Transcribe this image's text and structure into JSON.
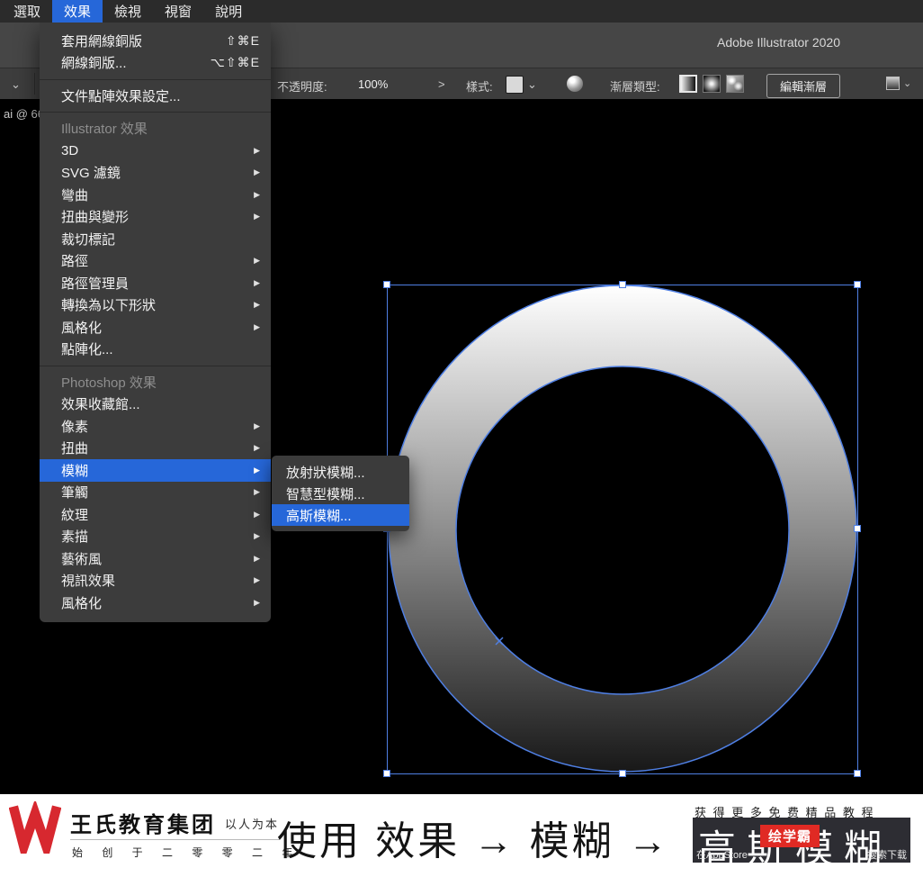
{
  "menubar": {
    "items": [
      {
        "label": "選取",
        "active": false
      },
      {
        "label": "效果",
        "active": true
      },
      {
        "label": "檢視",
        "active": false
      },
      {
        "label": "視窗",
        "active": false
      },
      {
        "label": "說明",
        "active": false
      }
    ]
  },
  "titlebar": {
    "title": "Adobe Illustrator 2020"
  },
  "controlbar": {
    "opacity_label": "不透明度:",
    "opacity_value": "100%",
    "style_label": "樣式:",
    "gradient_type_label": "漸層類型:",
    "edit_gradient_button": "編輯漸層"
  },
  "document": {
    "tab_fragment": "ai @ 66"
  },
  "effect_menu": {
    "items": [
      {
        "type": "item",
        "label": "套用網線銅版",
        "shortcut": "⇧⌘E"
      },
      {
        "type": "item",
        "label": "網線銅版...",
        "shortcut": "⌥⇧⌘E"
      },
      {
        "type": "separator"
      },
      {
        "type": "item",
        "label": "文件點陣效果設定..."
      },
      {
        "type": "separator"
      },
      {
        "type": "header",
        "label": "Illustrator 效果"
      },
      {
        "type": "item",
        "label": "3D",
        "submenu": true
      },
      {
        "type": "item",
        "label": "SVG 濾鏡",
        "submenu": true
      },
      {
        "type": "item",
        "label": "彎曲",
        "submenu": true
      },
      {
        "type": "item",
        "label": "扭曲與變形",
        "submenu": true
      },
      {
        "type": "item",
        "label": "裁切標記"
      },
      {
        "type": "item",
        "label": "路徑",
        "submenu": true
      },
      {
        "type": "item",
        "label": "路徑管理員",
        "submenu": true
      },
      {
        "type": "item",
        "label": "轉換為以下形狀",
        "submenu": true
      },
      {
        "type": "item",
        "label": "風格化",
        "submenu": true
      },
      {
        "type": "item",
        "label": "點陣化..."
      },
      {
        "type": "separator"
      },
      {
        "type": "header",
        "label": "Photoshop 效果"
      },
      {
        "type": "item",
        "label": "效果收藏館..."
      },
      {
        "type": "item",
        "label": "像素",
        "submenu": true
      },
      {
        "type": "item",
        "label": "扭曲",
        "submenu": true
      },
      {
        "type": "item",
        "label": "模糊",
        "submenu": true,
        "highlighted": true
      },
      {
        "type": "item",
        "label": "筆觸",
        "submenu": true
      },
      {
        "type": "item",
        "label": "紋理",
        "submenu": true
      },
      {
        "type": "item",
        "label": "素描",
        "submenu": true
      },
      {
        "type": "item",
        "label": "藝術風",
        "submenu": true
      },
      {
        "type": "item",
        "label": "視訊效果",
        "submenu": true
      },
      {
        "type": "item",
        "label": "風格化",
        "submenu": true
      }
    ]
  },
  "blur_submenu": {
    "items": [
      {
        "label": "放射狀模糊...",
        "highlighted": false
      },
      {
        "label": "智慧型模糊...",
        "highlighted": false
      },
      {
        "label": "高斯模糊...",
        "highlighted": true
      }
    ]
  },
  "canvas": {
    "selection_color": "#4f7fe3",
    "gradient_top": "#ffffff",
    "gradient_mid": "#8f8f8f",
    "gradient_bottom": "#181818"
  },
  "footer": {
    "brand_name": "王氏教育集团",
    "brand_slogan": "以人为本",
    "brand_sub": "始 创 于 二 零 零 二 年",
    "caption_prefix": "使用 效果 → 模糊 →",
    "caption_highlight": "高斯模糊",
    "promo_line1": "获 得 更 多 免 费 精 品 教 程",
    "promo_badge": "绘学霸",
    "promo_line2_left": "在AppStore",
    "promo_line2_right": "搜索下载"
  }
}
